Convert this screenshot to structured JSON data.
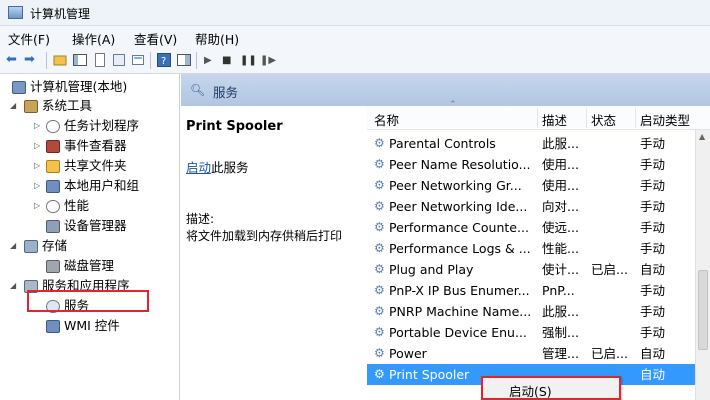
{
  "window": {
    "title": "计算机管理"
  },
  "menu": [
    "文件(F)",
    "操作(A)",
    "查看(V)",
    "帮助(H)"
  ],
  "tree": {
    "root": "计算机管理(本地)",
    "system_tools": "系统工具",
    "system_children": [
      "任务计划程序",
      "事件查看器",
      "共享文件夹",
      "本地用户和组",
      "性能",
      "设备管理器"
    ],
    "storage": "存储",
    "storage_children": [
      "磁盘管理"
    ],
    "services_apps": "服务和应用程序",
    "services_children": [
      "服务",
      "WMI 控件"
    ]
  },
  "content": {
    "header_title": "服务",
    "selected_service": "Print Spooler",
    "start_link": "启动",
    "start_suffix": "此服务",
    "desc_label": "描述:",
    "desc_text": "将文件加载到内存供稍后打印"
  },
  "columns": {
    "name": "名称",
    "desc": "描述",
    "status": "状态",
    "startup": "启动类型"
  },
  "services": [
    {
      "name": "Parental Controls",
      "desc": "此服...",
      "status": "",
      "startup": "手动"
    },
    {
      "name": "Peer Name Resolutio...",
      "desc": "使用...",
      "status": "",
      "startup": "手动"
    },
    {
      "name": "Peer Networking Gr...",
      "desc": "使用...",
      "status": "",
      "startup": "手动"
    },
    {
      "name": "Peer Networking Ide...",
      "desc": "向对...",
      "status": "",
      "startup": "手动"
    },
    {
      "name": "Performance Counte...",
      "desc": "使远...",
      "status": "",
      "startup": "手动"
    },
    {
      "name": "Performance Logs & ...",
      "desc": "性能...",
      "status": "",
      "startup": "手动"
    },
    {
      "name": "Plug and Play",
      "desc": "使计...",
      "status": "已启...",
      "startup": "自动"
    },
    {
      "name": "PnP-X IP Bus Enumer...",
      "desc": "PnP...",
      "status": "",
      "startup": "手动"
    },
    {
      "name": "PNRP Machine Name...",
      "desc": "此服...",
      "status": "",
      "startup": "手动"
    },
    {
      "name": "Portable Device Enu...",
      "desc": "强制...",
      "status": "",
      "startup": "手动"
    },
    {
      "name": "Power",
      "desc": "管理...",
      "status": "已启...",
      "startup": "自动"
    },
    {
      "name": "Print Spooler",
      "desc": "",
      "status": "",
      "startup": "自动"
    }
  ],
  "context_menu": {
    "start": "启动(S)"
  },
  "colors": {
    "selection": "#3399ff",
    "highlight_box": "#e0262c",
    "header": "#b1c6e3"
  }
}
